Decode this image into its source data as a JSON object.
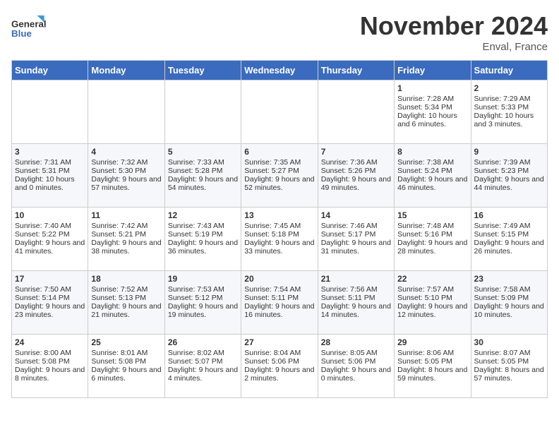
{
  "logo": {
    "line1": "General",
    "line2": "Blue"
  },
  "title": "November 2024",
  "location": "Enval, France",
  "days_of_week": [
    "Sunday",
    "Monday",
    "Tuesday",
    "Wednesday",
    "Thursday",
    "Friday",
    "Saturday"
  ],
  "weeks": [
    [
      {
        "day": "",
        "content": ""
      },
      {
        "day": "",
        "content": ""
      },
      {
        "day": "",
        "content": ""
      },
      {
        "day": "",
        "content": ""
      },
      {
        "day": "",
        "content": ""
      },
      {
        "day": "1",
        "content": "Sunrise: 7:28 AM\nSunset: 5:34 PM\nDaylight: 10 hours and 6 minutes."
      },
      {
        "day": "2",
        "content": "Sunrise: 7:29 AM\nSunset: 5:33 PM\nDaylight: 10 hours and 3 minutes."
      }
    ],
    [
      {
        "day": "3",
        "content": "Sunrise: 7:31 AM\nSunset: 5:31 PM\nDaylight: 10 hours and 0 minutes."
      },
      {
        "day": "4",
        "content": "Sunrise: 7:32 AM\nSunset: 5:30 PM\nDaylight: 9 hours and 57 minutes."
      },
      {
        "day": "5",
        "content": "Sunrise: 7:33 AM\nSunset: 5:28 PM\nDaylight: 9 hours and 54 minutes."
      },
      {
        "day": "6",
        "content": "Sunrise: 7:35 AM\nSunset: 5:27 PM\nDaylight: 9 hours and 52 minutes."
      },
      {
        "day": "7",
        "content": "Sunrise: 7:36 AM\nSunset: 5:26 PM\nDaylight: 9 hours and 49 minutes."
      },
      {
        "day": "8",
        "content": "Sunrise: 7:38 AM\nSunset: 5:24 PM\nDaylight: 9 hours and 46 minutes."
      },
      {
        "day": "9",
        "content": "Sunrise: 7:39 AM\nSunset: 5:23 PM\nDaylight: 9 hours and 44 minutes."
      }
    ],
    [
      {
        "day": "10",
        "content": "Sunrise: 7:40 AM\nSunset: 5:22 PM\nDaylight: 9 hours and 41 minutes."
      },
      {
        "day": "11",
        "content": "Sunrise: 7:42 AM\nSunset: 5:21 PM\nDaylight: 9 hours and 38 minutes."
      },
      {
        "day": "12",
        "content": "Sunrise: 7:43 AM\nSunset: 5:19 PM\nDaylight: 9 hours and 36 minutes."
      },
      {
        "day": "13",
        "content": "Sunrise: 7:45 AM\nSunset: 5:18 PM\nDaylight: 9 hours and 33 minutes."
      },
      {
        "day": "14",
        "content": "Sunrise: 7:46 AM\nSunset: 5:17 PM\nDaylight: 9 hours and 31 minutes."
      },
      {
        "day": "15",
        "content": "Sunrise: 7:48 AM\nSunset: 5:16 PM\nDaylight: 9 hours and 28 minutes."
      },
      {
        "day": "16",
        "content": "Sunrise: 7:49 AM\nSunset: 5:15 PM\nDaylight: 9 hours and 26 minutes."
      }
    ],
    [
      {
        "day": "17",
        "content": "Sunrise: 7:50 AM\nSunset: 5:14 PM\nDaylight: 9 hours and 23 minutes."
      },
      {
        "day": "18",
        "content": "Sunrise: 7:52 AM\nSunset: 5:13 PM\nDaylight: 9 hours and 21 minutes."
      },
      {
        "day": "19",
        "content": "Sunrise: 7:53 AM\nSunset: 5:12 PM\nDaylight: 9 hours and 19 minutes."
      },
      {
        "day": "20",
        "content": "Sunrise: 7:54 AM\nSunset: 5:11 PM\nDaylight: 9 hours and 16 minutes."
      },
      {
        "day": "21",
        "content": "Sunrise: 7:56 AM\nSunset: 5:11 PM\nDaylight: 9 hours and 14 minutes."
      },
      {
        "day": "22",
        "content": "Sunrise: 7:57 AM\nSunset: 5:10 PM\nDaylight: 9 hours and 12 minutes."
      },
      {
        "day": "23",
        "content": "Sunrise: 7:58 AM\nSunset: 5:09 PM\nDaylight: 9 hours and 10 minutes."
      }
    ],
    [
      {
        "day": "24",
        "content": "Sunrise: 8:00 AM\nSunset: 5:08 PM\nDaylight: 9 hours and 8 minutes."
      },
      {
        "day": "25",
        "content": "Sunrise: 8:01 AM\nSunset: 5:08 PM\nDaylight: 9 hours and 6 minutes."
      },
      {
        "day": "26",
        "content": "Sunrise: 8:02 AM\nSunset: 5:07 PM\nDaylight: 9 hours and 4 minutes."
      },
      {
        "day": "27",
        "content": "Sunrise: 8:04 AM\nSunset: 5:06 PM\nDaylight: 9 hours and 2 minutes."
      },
      {
        "day": "28",
        "content": "Sunrise: 8:05 AM\nSunset: 5:06 PM\nDaylight: 9 hours and 0 minutes."
      },
      {
        "day": "29",
        "content": "Sunrise: 8:06 AM\nSunset: 5:05 PM\nDaylight: 8 hours and 59 minutes."
      },
      {
        "day": "30",
        "content": "Sunrise: 8:07 AM\nSunset: 5:05 PM\nDaylight: 8 hours and 57 minutes."
      }
    ]
  ]
}
